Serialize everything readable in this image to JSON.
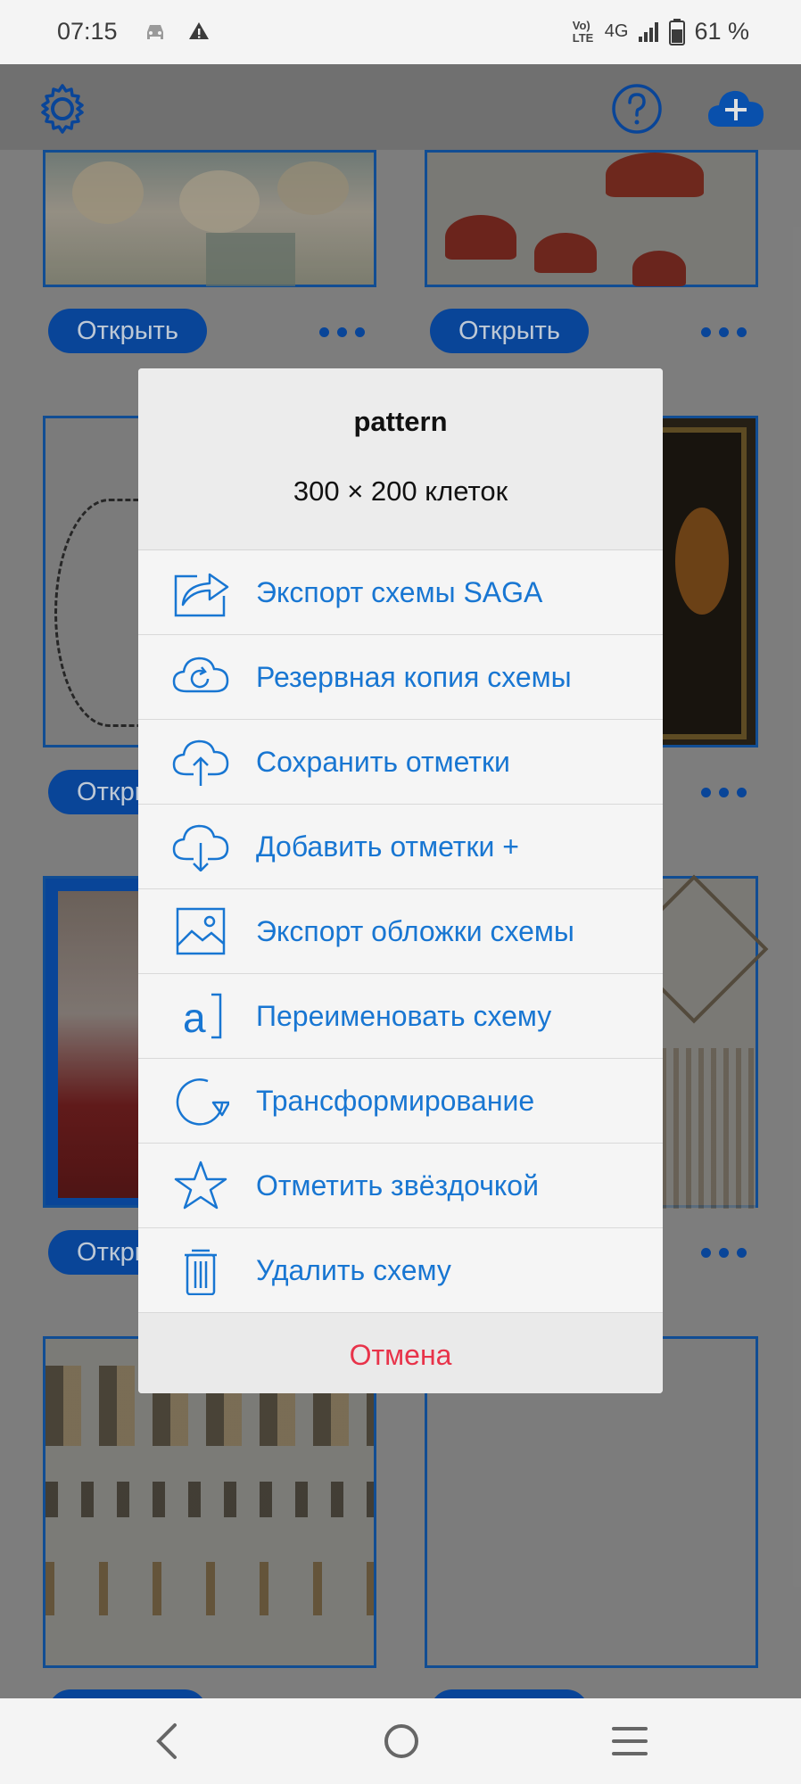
{
  "status_bar": {
    "time": "07:15",
    "network_volte": "Vo) LTE",
    "network_type": "4G",
    "battery": "61 %",
    "icons": [
      "car-icon",
      "warning-icon",
      "signal-icon",
      "battery-icon"
    ]
  },
  "header": {
    "icons": [
      "gear-icon",
      "help-icon",
      "add-icon"
    ],
    "accent": "#0b5cc4"
  },
  "grid": {
    "open_label": "Открыть",
    "open_label_partial": "Откр"
  },
  "dialog": {
    "title": "pattern",
    "subtitle": "300 × 200 клеток",
    "items": [
      {
        "label": "Экспорт схемы SAGA",
        "icon": "export-icon"
      },
      {
        "label": "Резервная копия схемы",
        "icon": "cloud-backup-icon"
      },
      {
        "label": "Сохранить отметки",
        "icon": "cloud-upload-icon"
      },
      {
        "label": "Добавить отметки +",
        "icon": "cloud-download-icon"
      },
      {
        "label": "Экспорт обложки схемы",
        "icon": "image-icon"
      },
      {
        "label": "Переименовать схему",
        "icon": "rename-icon"
      },
      {
        "label": "Трансформирование",
        "icon": "rotate-icon"
      },
      {
        "label": "Отметить звёздочкой",
        "icon": "star-icon"
      },
      {
        "label": "Удалить схему",
        "icon": "trash-icon"
      }
    ],
    "cancel_label": "Отмена",
    "accent": "#1876d2",
    "cancel_color": "#e8334a"
  },
  "nav_bar": {
    "icons": [
      "back-icon",
      "home-icon",
      "menu-icon"
    ]
  }
}
